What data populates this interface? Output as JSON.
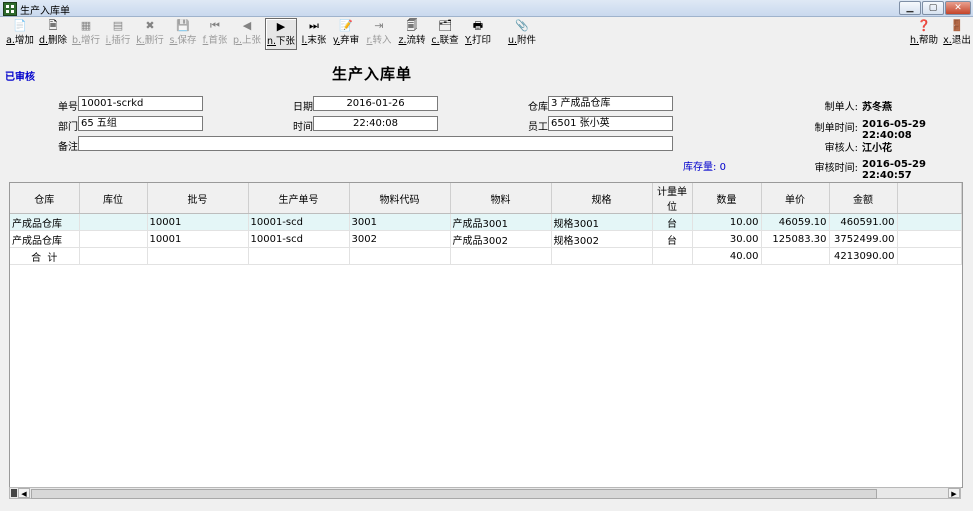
{
  "window": {
    "title": "生产入库单",
    "min_label": "▁",
    "max_label": "▢",
    "close_label": "✕"
  },
  "toolbar": {
    "add": {
      "key": "a.",
      "label": "增加",
      "icon": "add-doc-icon"
    },
    "delete": {
      "key": "d.",
      "label": "删除",
      "icon": "delete-doc-icon"
    },
    "add_row": {
      "key": "b.",
      "label": "增行",
      "icon": "add-row-icon"
    },
    "insert_row": {
      "key": "i.",
      "label": "插行",
      "icon": "insert-row-icon"
    },
    "delete_row": {
      "key": "k.",
      "label": "删行",
      "icon": "delete-row-icon"
    },
    "save": {
      "key": "s.",
      "label": "保存",
      "icon": "save-icon"
    },
    "first": {
      "key": "f.",
      "label": "首张",
      "icon": "first-record-icon"
    },
    "prev": {
      "key": "p.",
      "label": "上张",
      "icon": "prev-record-icon"
    },
    "next": {
      "key": "n.",
      "label": "下张",
      "icon": "next-record-icon"
    },
    "last": {
      "key": "l.",
      "label": "末张",
      "icon": "last-record-icon"
    },
    "unaudit": {
      "key": "y.",
      "label": "弃审",
      "icon": "unaudit-icon"
    },
    "transfer_in": {
      "key": "r.",
      "label": "转入",
      "icon": "transfer-in-icon"
    },
    "flow": {
      "key": "z.",
      "label": "流转",
      "icon": "flow-icon"
    },
    "link_query": {
      "key": "c.",
      "label": "联查",
      "icon": "link-query-icon"
    },
    "print": {
      "key": "Y.",
      "label": "打印",
      "icon": "print-icon"
    },
    "attach": {
      "key": "u.",
      "label": "附件",
      "icon": "attachment-icon"
    },
    "help": {
      "key": "h.",
      "label": "帮助",
      "icon": "help-icon"
    },
    "exit": {
      "key": "x.",
      "label": "退出",
      "icon": "exit-icon"
    }
  },
  "status_text": "已审核",
  "form_title": "生产入库单",
  "header": {
    "bill_no_label": "单号",
    "bill_no": "10001-scrkd",
    "dept_label": "部门",
    "dept": "65 五组",
    "remark_label": "备注",
    "remark": "",
    "date_label": "日期",
    "date": "2016-01-26",
    "time_label": "时间",
    "time": "22:40:08",
    "warehouse_label": "仓库",
    "warehouse": "3 产成品仓库",
    "employee_label": "员工",
    "employee": "6501 张小英",
    "maker_label": "制单人:",
    "maker": "苏冬燕",
    "make_time_label": "制单时间:",
    "make_time": "2016-05-29 22:40:08",
    "auditor_label": "审核人:",
    "auditor": "江小花",
    "audit_time_label": "审核时间:",
    "audit_time": "2016-05-29 22:40:57",
    "stock_label": "库存量:",
    "stock": "0"
  },
  "grid": {
    "columns": [
      "仓库",
      "库位",
      "批号",
      "生产单号",
      "物料代码",
      "物料",
      "规格",
      "计量单位",
      "数量",
      "单价",
      "金额"
    ],
    "rows": [
      [
        "产成品仓库",
        "",
        "10001",
        "10001-scd",
        "3001",
        "产成品3001",
        "规格3001",
        "台",
        "10.00",
        "46059.10",
        "460591.00"
      ],
      [
        "产成品仓库",
        "",
        "10001",
        "10001-scd",
        "3002",
        "产成品3002",
        "规格3002",
        "台",
        "30.00",
        "125083.30",
        "3752499.00"
      ]
    ],
    "total": {
      "label": "合  计",
      "qty": "40.00",
      "amount": "4213090.00"
    }
  }
}
